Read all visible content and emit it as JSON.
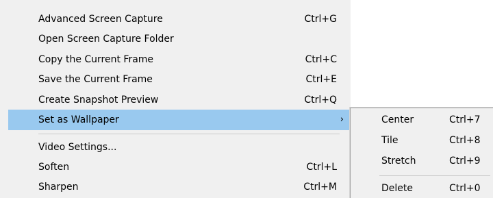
{
  "menu": {
    "items": [
      {
        "label": "Advanced Screen Capture",
        "shortcut": "Ctrl+G"
      },
      {
        "label": "Open Screen Capture Folder",
        "shortcut": ""
      },
      {
        "label": "Copy the Current Frame",
        "shortcut": "Ctrl+C"
      },
      {
        "label": "Save the Current Frame",
        "shortcut": "Ctrl+E"
      },
      {
        "label": "Create Snapshot Preview",
        "shortcut": "Ctrl+Q"
      },
      {
        "label": "Set as Wallpaper",
        "shortcut": "",
        "submenu_arrow": "›",
        "selected": true
      },
      {
        "label": "Video Settings...",
        "shortcut": ""
      },
      {
        "label": "Soften",
        "shortcut": "Ctrl+L"
      },
      {
        "label": "Sharpen",
        "shortcut": "Ctrl+M"
      }
    ]
  },
  "submenu": {
    "items": [
      {
        "label": "Center",
        "shortcut": "Ctrl+7"
      },
      {
        "label": "Tile",
        "shortcut": "Ctrl+8"
      },
      {
        "label": "Stretch",
        "shortcut": "Ctrl+9"
      },
      {
        "label": "Delete",
        "shortcut": "Ctrl+0"
      }
    ]
  },
  "colors": {
    "menu_background": "#f0f0f0",
    "selection_highlight": "#99c9ef",
    "separator": "#c8c8c8",
    "text": "#000000"
  }
}
